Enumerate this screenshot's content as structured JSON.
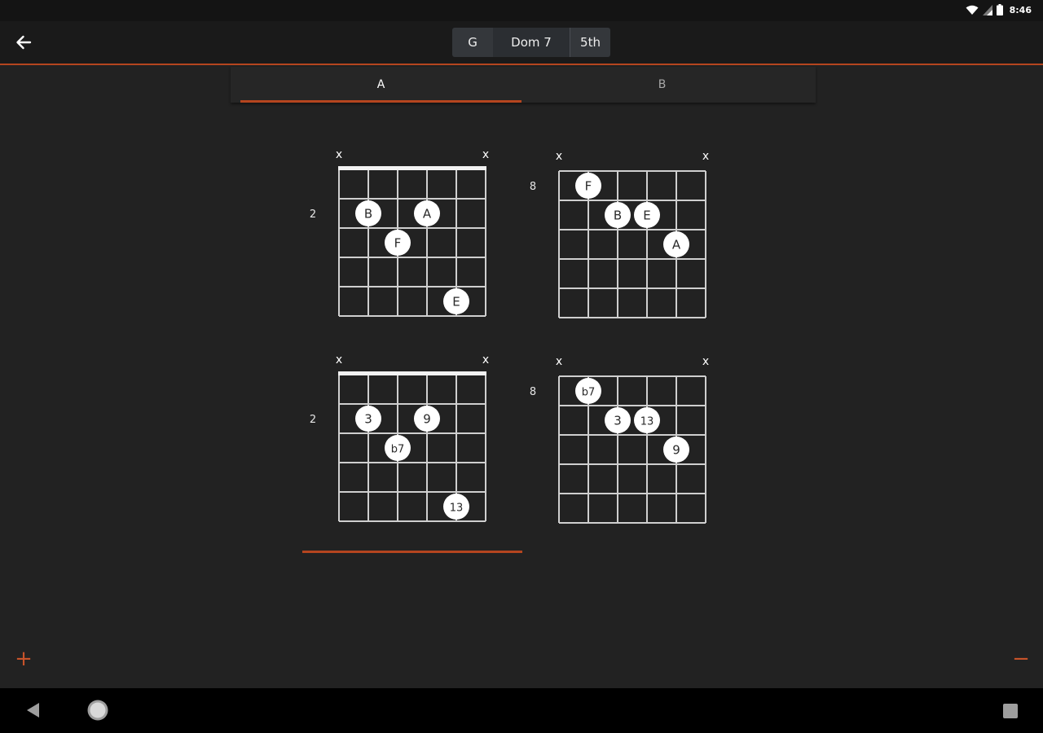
{
  "status": {
    "time": "8:46",
    "icons": [
      "wifi-icon",
      "signal-icon",
      "battery-icon"
    ]
  },
  "toolbar": {
    "back_icon": "arrow-left-icon",
    "root": "G",
    "chord_type": "Dom 7",
    "position": "5th"
  },
  "tabs": [
    {
      "label": "A",
      "selected": true
    },
    {
      "label": "B",
      "selected": false
    }
  ],
  "colors": {
    "accent": "#b5451f",
    "background": "#222222",
    "grid": "#cfcfcf",
    "dot": "#ffffff"
  },
  "diagrams": [
    {
      "id": "a-notes",
      "fret_label": "2",
      "nut": true,
      "muted": [
        "x",
        "",
        "",
        "",
        "",
        "x"
      ],
      "dots": [
        {
          "string": 2,
          "fret": 2,
          "label": "B"
        },
        {
          "string": 4,
          "fret": 2,
          "label": "A"
        },
        {
          "string": 3,
          "fret": 3,
          "label": "F"
        },
        {
          "string": 5,
          "fret": 5,
          "label": "E"
        }
      ]
    },
    {
      "id": "b-notes",
      "fret_label": "8",
      "nut": false,
      "muted": [
        "x",
        "",
        "",
        "",
        "",
        "x"
      ],
      "dots": [
        {
          "string": 2,
          "fret": 1,
          "label": "F"
        },
        {
          "string": 3,
          "fret": 2,
          "label": "B"
        },
        {
          "string": 4,
          "fret": 2,
          "label": "E"
        },
        {
          "string": 5,
          "fret": 3,
          "label": "A"
        }
      ]
    },
    {
      "id": "a-intervals",
      "fret_label": "2",
      "nut": true,
      "muted": [
        "x",
        "",
        "",
        "",
        "",
        "x"
      ],
      "dots": [
        {
          "string": 2,
          "fret": 2,
          "label": "3"
        },
        {
          "string": 4,
          "fret": 2,
          "label": "9"
        },
        {
          "string": 3,
          "fret": 3,
          "label": "b7"
        },
        {
          "string": 5,
          "fret": 5,
          "label": "13"
        }
      ]
    },
    {
      "id": "b-intervals",
      "fret_label": "8",
      "nut": false,
      "muted": [
        "x",
        "",
        "",
        "",
        "",
        "x"
      ],
      "dots": [
        {
          "string": 2,
          "fret": 1,
          "label": "b7"
        },
        {
          "string": 3,
          "fret": 2,
          "label": "3"
        },
        {
          "string": 4,
          "fret": 2,
          "label": "13"
        },
        {
          "string": 5,
          "fret": 3,
          "label": "9"
        }
      ]
    }
  ],
  "actions": {
    "add_label": "+",
    "remove_label": "−"
  },
  "navbar": {
    "icons": [
      "nav-back-icon",
      "nav-home-icon",
      "nav-recents-icon"
    ]
  }
}
